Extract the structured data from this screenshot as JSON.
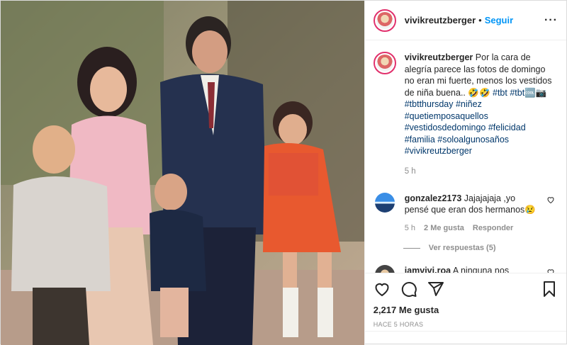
{
  "header": {
    "username": "vivikreutzberger",
    "separator": "•",
    "follow_label": "Seguir",
    "more_label": "···"
  },
  "caption": {
    "username": "vivikreutzberger",
    "text": "Por la cara de alegría parece las fotos de domingo no eran mi fuerte, menos los vestidos de niña buena.. 🤣🤣",
    "inline_tags": "#tbt #tbt🆒📷",
    "hashtags": [
      "#tbtthursday #niñez",
      "#quetiemposaquellos",
      "#vestidosdedomingo #felicidad",
      "#familia #soloalgunosaños",
      "#vivikreutzberger"
    ],
    "time": "5 h"
  },
  "comments": [
    {
      "username": "gonzalez2173",
      "text": "Jajajajaja ,yo pensé que eran dos hermanos😢",
      "time": "5 h",
      "likes": "2 Me gusta",
      "reply": "Responder",
      "view_replies": "Ver respuestas (5)"
    },
    {
      "username": "iamvivi.roa",
      "text": "A ninguna nos"
    }
  ],
  "actions": {
    "likes": "2,217 Me gusta",
    "date": "HACE 5 HORAS"
  },
  "icons": [
    "heart-icon",
    "comment-icon",
    "share-icon",
    "bookmark-icon",
    "more-icon",
    "small-heart-icon"
  ],
  "colors": {
    "accent": "#0095f6",
    "hashtag": "#00376b",
    "muted": "#8e8e8e"
  }
}
